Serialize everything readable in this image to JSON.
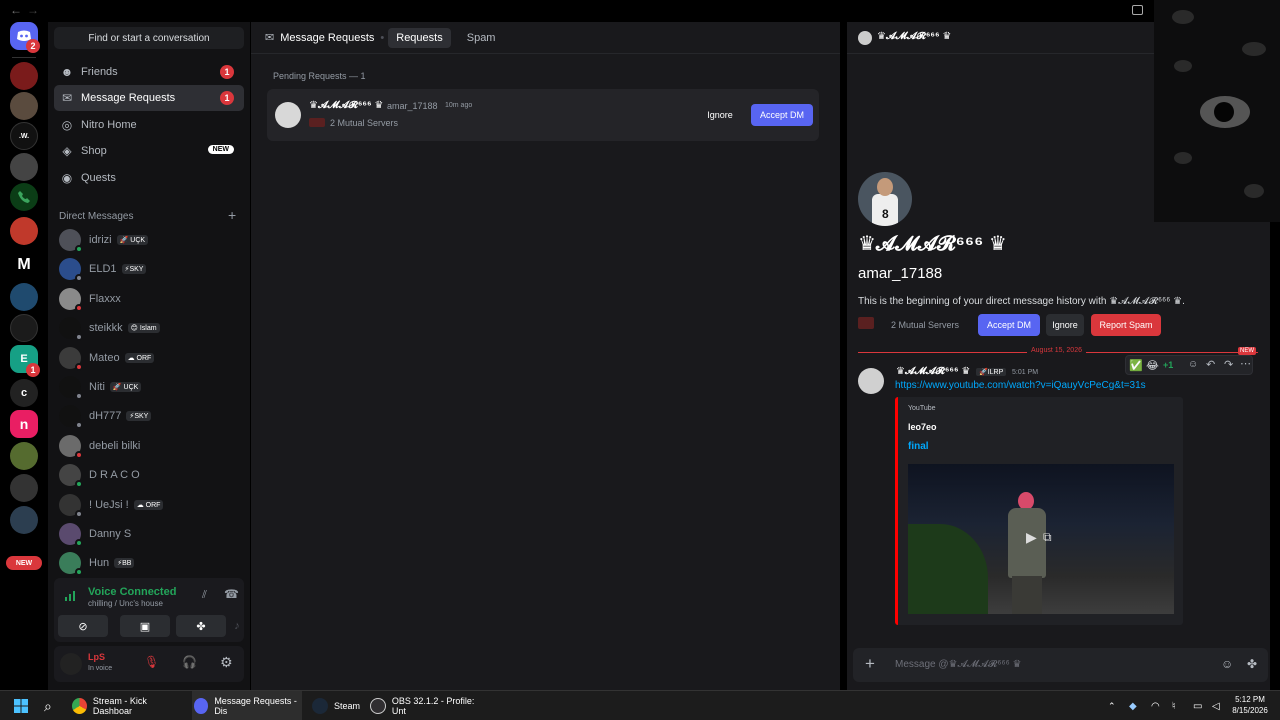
{
  "window": {
    "back": "←",
    "forward": "→"
  },
  "servers": [
    {
      "label": "",
      "badge": "2"
    },
    {
      "label": ""
    },
    {
      "label": ""
    },
    {
      "label": ".W."
    },
    {
      "label": ""
    },
    {
      "label": ""
    },
    {
      "label": ""
    },
    {
      "label": "M"
    },
    {
      "label": ""
    },
    {
      "label": ""
    },
    {
      "label": "E",
      "badge": "1"
    },
    {
      "label": "c"
    },
    {
      "label": "n"
    },
    {
      "label": ""
    },
    {
      "label": ""
    },
    {
      "label": ""
    },
    {
      "label": "NEW"
    }
  ],
  "search": {
    "label": "Find or start a conversation"
  },
  "nav": [
    {
      "label": "Friends",
      "badge": "1",
      "icon": "friends-icon"
    },
    {
      "label": "Message Requests",
      "badge": "1",
      "icon": "mail-icon"
    },
    {
      "label": "Nitro Home",
      "icon": "nitro-icon"
    },
    {
      "label": "Shop",
      "pill": "NEW",
      "icon": "shop-icon"
    },
    {
      "label": "Quests",
      "icon": "quests-icon"
    }
  ],
  "dm_header": "Direct Messages",
  "dms": [
    {
      "name": "idrizi",
      "tag": "🚀 UÇK",
      "color": "#4e5058"
    },
    {
      "name": "ΕLD1",
      "tag": "⚡SKY",
      "color": "#2b4d8c"
    },
    {
      "name": "Flaxxx",
      "tag": "",
      "color": "#8a8a8a"
    },
    {
      "name": "steikkk",
      "tag": "😊 Islam",
      "color": "#111"
    },
    {
      "name": "Mateo",
      "tag": "☁ ORF",
      "color": "#3b3b3b"
    },
    {
      "name": "Niti",
      "tag": "🚀 UÇK",
      "color": "#111"
    },
    {
      "name": "dH777",
      "tag": "⚡SKY",
      "color": "#111"
    },
    {
      "name": "debeli bilki",
      "tag": "",
      "color": "#6b6b6b"
    },
    {
      "name": "D R A C O",
      "tag": "",
      "color": "#444"
    },
    {
      "name": "! UeJsi !",
      "tag": "☁ ORF",
      "color": "#333"
    },
    {
      "name": "Danny S",
      "tag": "",
      "color": "#5a4a6e"
    },
    {
      "name": "Hun",
      "tag": "⚡BB",
      "color": "#3a7d5a"
    }
  ],
  "voice": {
    "title": "Voice Connected",
    "sub": "chilling / Unc's house"
  },
  "user": {
    "name": "LpS",
    "status": "In voice"
  },
  "main": {
    "tabs": [
      {
        "label": "Message Requests"
      },
      {
        "label": "Requests"
      },
      {
        "label": "Spam"
      }
    ],
    "pending": "Pending Requests — 1",
    "request": {
      "name": "♛𝓐𝓜𝓐𝓡⁶⁶⁶ ♛",
      "username": "amar_17188",
      "time": "10m ago",
      "mutual": "2 Mutual Servers",
      "ignore": "Ignore",
      "accept": "Accept DM"
    }
  },
  "profile": {
    "header_name": "♛𝓐𝓜𝓐𝓡⁶⁶⁶ ♛",
    "display_name": "♛𝓐𝓜𝓐𝓡⁶⁶⁶ ♛",
    "username": "amar_17188",
    "intro": "This is the beginning of your direct message history with ♛𝓐𝓜𝓐𝓡⁶⁶⁶ ♛.",
    "mutual": "2 Mutual Servers",
    "accept": "Accept DM",
    "ignore": "Ignore",
    "report": "Report Spam"
  },
  "message": {
    "date": "August 15, 2026",
    "new": "NEW",
    "author": "♛𝓐𝓜𝓐𝓡⁶⁶⁶ ♛",
    "author_tag": "🚀ILRP",
    "time": "5:01 PM",
    "link": "https://www.youtube.com/watch?v=iQauyVcPeCg&t=31s",
    "embed": {
      "provider": "YouTube",
      "author": "leo7eo",
      "title": "final"
    },
    "reaction": "+1"
  },
  "composer": {
    "placeholder": "Message @♛𝓐𝓜𝓐𝓡⁶⁶⁶ ♛"
  },
  "taskbar": [
    {
      "label": "Stream - Kick Dashboar"
    },
    {
      "label": "Message Requests - Dis"
    },
    {
      "label": "Steam"
    },
    {
      "label": "OBS 32.1.2 - Profile: Unt"
    }
  ],
  "clock": {
    "time": "5:12 PM",
    "date": "8/15/2026"
  }
}
